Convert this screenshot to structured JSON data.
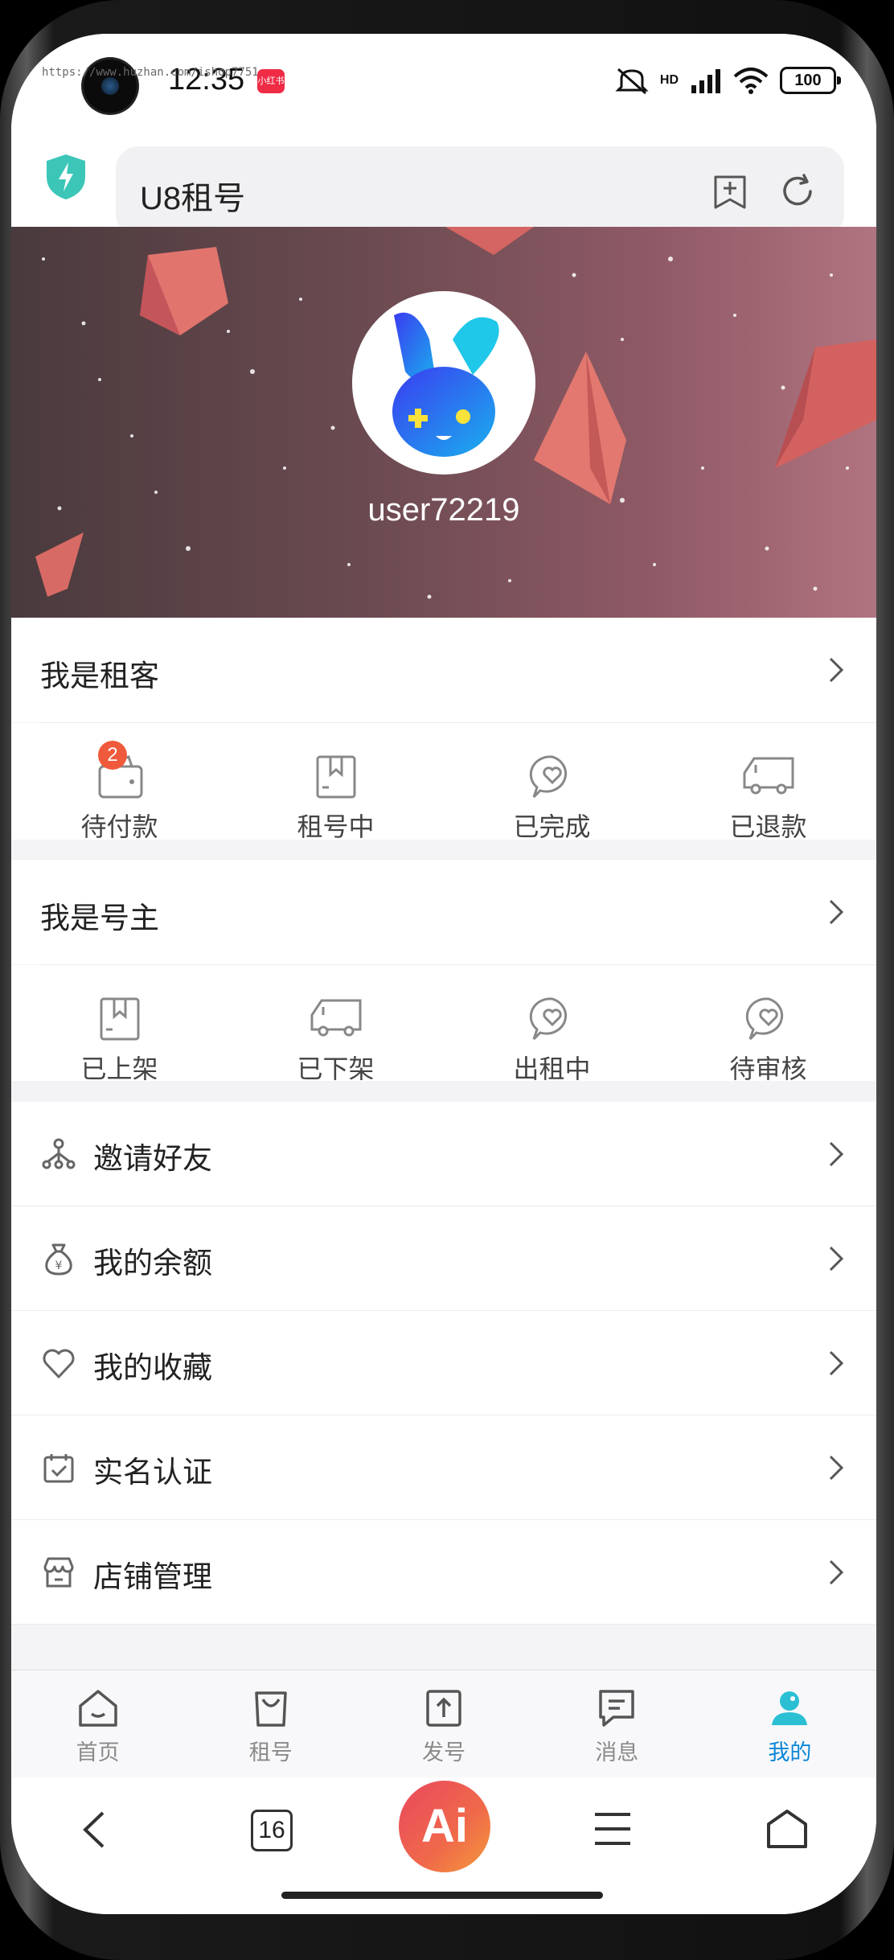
{
  "watermark": "https://www.huzhan.com/ishop7751",
  "status_bar": {
    "time": "12:35",
    "app_badge": "小红书",
    "battery": "100",
    "network": "HD"
  },
  "browser": {
    "title": "U8租号"
  },
  "profile": {
    "username": "user72219"
  },
  "renter": {
    "title": "我是租客",
    "items": [
      {
        "label": "待付款",
        "icon": "wallet-icon",
        "badge": "2"
      },
      {
        "label": "租号中",
        "icon": "bookmark-icon"
      },
      {
        "label": "已完成",
        "icon": "heart-chat-icon"
      },
      {
        "label": "已退款",
        "icon": "truck-icon"
      }
    ]
  },
  "owner": {
    "title": "我是号主",
    "items": [
      {
        "label": "已上架",
        "icon": "bookmark-icon"
      },
      {
        "label": "已下架",
        "icon": "truck-icon"
      },
      {
        "label": "出租中",
        "icon": "heart-chat-icon"
      },
      {
        "label": "待审核",
        "icon": "heart-chat-icon"
      }
    ]
  },
  "menu": [
    {
      "label": "邀请好友",
      "icon": "share-network-icon"
    },
    {
      "label": "我的余额",
      "icon": "money-bag-icon"
    },
    {
      "label": "我的收藏",
      "icon": "heart-icon"
    },
    {
      "label": "实名认证",
      "icon": "calendar-check-icon"
    },
    {
      "label": "店铺管理",
      "icon": "store-icon"
    }
  ],
  "tabs": [
    {
      "label": "首页",
      "icon": "home-icon"
    },
    {
      "label": "租号",
      "icon": "bag-icon"
    },
    {
      "label": "发号",
      "icon": "upload-icon"
    },
    {
      "label": "消息",
      "icon": "message-icon"
    },
    {
      "label": "我的",
      "icon": "user-icon",
      "active": true
    }
  ],
  "navbar": {
    "tab_count": "16",
    "ai_label": "Ai"
  },
  "colors": {
    "accent": "#0a86d8",
    "badge": "#ef5a3c",
    "ai_gradient_start": "#e8475e",
    "ai_gradient_end": "#f39a3a"
  }
}
